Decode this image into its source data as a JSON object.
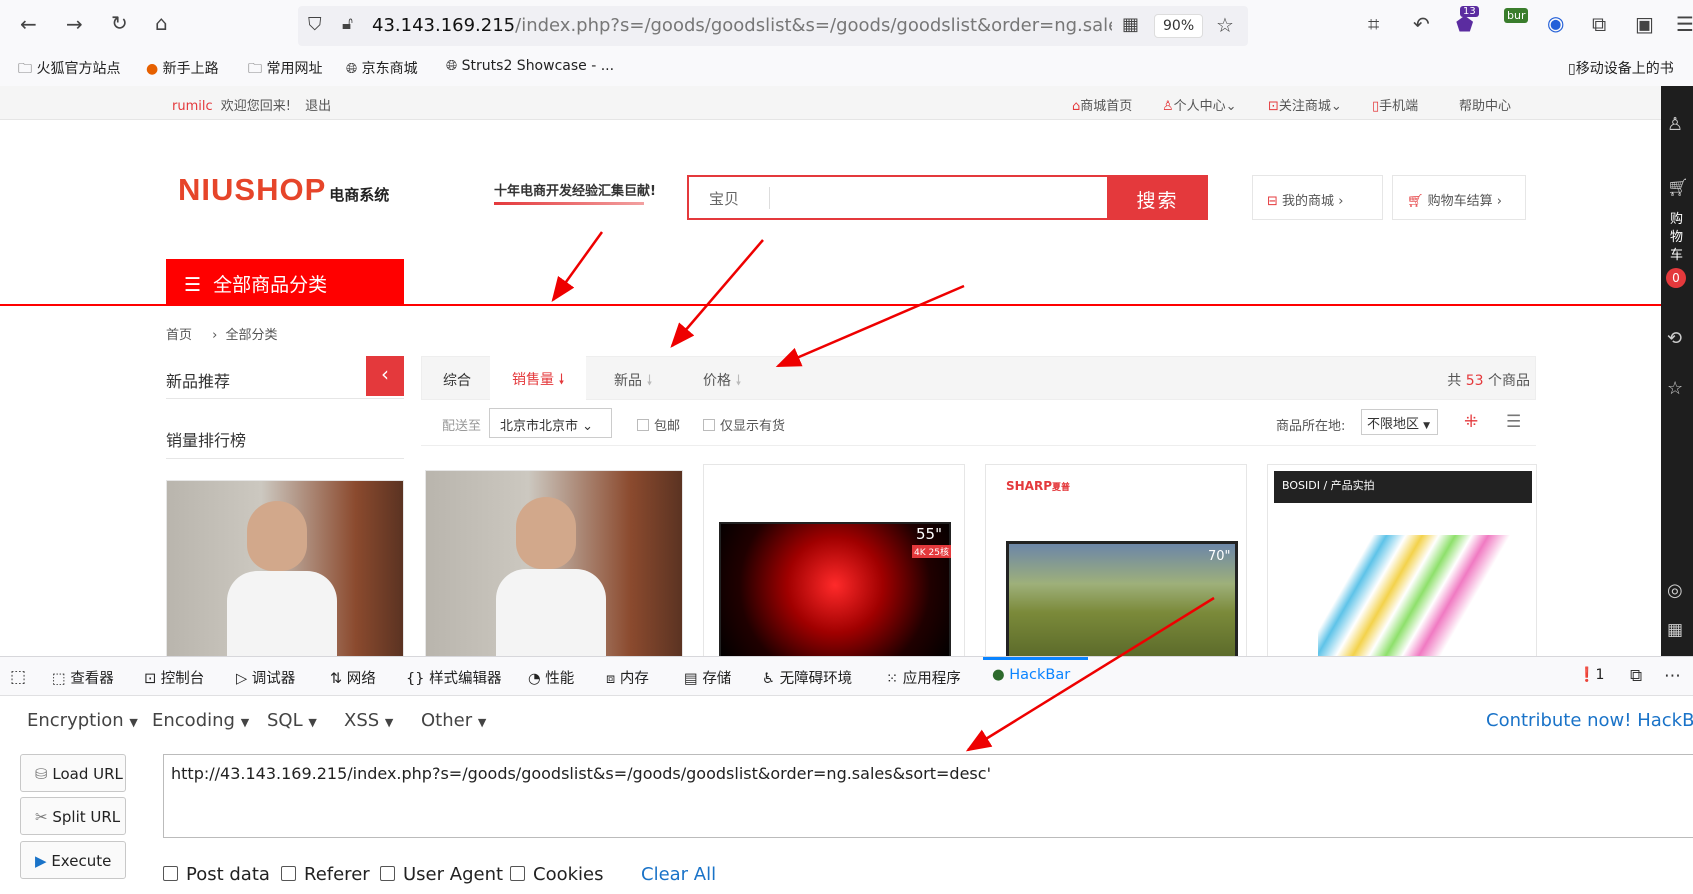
{
  "browser": {
    "url_host": "43.143.169.215",
    "url_path": "/index.php?s=/goods/goodslist&s=/goods/goodslist&order=ng.sales&so",
    "zoom": "90%",
    "badge_count": "13",
    "ext_label": "bur",
    "bookmarks": [
      "火狐官方站点",
      "新手上路",
      "常用网址",
      "京东商城",
      "Struts2 Showcase - ..."
    ],
    "mobile_bookmarks": "移动设备上的书"
  },
  "site": {
    "user": "rumilc",
    "welcome": "欢迎您回来!",
    "logout": "退出",
    "top_links": [
      "商城首页",
      "个人中心",
      "关注商城",
      "手机端",
      "帮助中心"
    ],
    "logo_main": "NIUSHOP",
    "logo_sub": "电商系统",
    "slogan": "十年电商开发经验汇集巨献!",
    "search_placeholder": "宝贝",
    "search_button": "搜索",
    "my_shop": "我的商城",
    "cart_checkout": "购物车结算",
    "all_categories": "全部商品分类",
    "breadcrumb_home": "首页",
    "breadcrumb_current": "全部分类",
    "new_recommend": "新品推荐",
    "sales_rank": "销量排行榜",
    "sort_tabs": [
      "综合",
      "销售量",
      "新品",
      "价格"
    ],
    "total_prefix": "共",
    "total_count": "53",
    "total_suffix": "个商品",
    "ship_to_label": "配送至",
    "ship_to_value": "北京市北京市",
    "free_shipping": "包邮",
    "in_stock_only": "仅显示有货",
    "location_label": "商品所在地:",
    "location_value": "不限地区",
    "side_cart": [
      "购",
      "物",
      "车"
    ],
    "side_cart_count": "0",
    "brand_sharp": "SHARP",
    "brand_sharp_cn": "夏普",
    "brand_bosidi": "BOSIDI / 产品实拍",
    "tv1_size": "55\"",
    "tv1_badge": "4K 25核",
    "tv2_size": "70\""
  },
  "devtools": {
    "tabs": [
      "查看器",
      "控制台",
      "调试器",
      "网络",
      "样式编辑器",
      "性能",
      "内存",
      "存储",
      "无障碍环境",
      "应用程序",
      "HackBar"
    ],
    "error_count": "1"
  },
  "hackbar": {
    "menus": [
      "Encryption",
      "Encoding",
      "SQL",
      "XSS",
      "Other"
    ],
    "contribute": "Contribute now! HackBar v",
    "buttons": [
      "Load URL",
      "Split URL",
      "Execute"
    ],
    "url_value": "http://43.143.169.215/index.php?s=/goods/goodslist&s=/goods/goodslist&order=ng.sales&sort=desc'",
    "checkboxes": [
      "Post data",
      "Referer",
      "User Agent",
      "Cookies"
    ],
    "clear_all": "Clear All"
  },
  "colors": {
    "accent": "#e4393c",
    "site_red": "#ff0000",
    "link_blue": "#1a73c8"
  }
}
